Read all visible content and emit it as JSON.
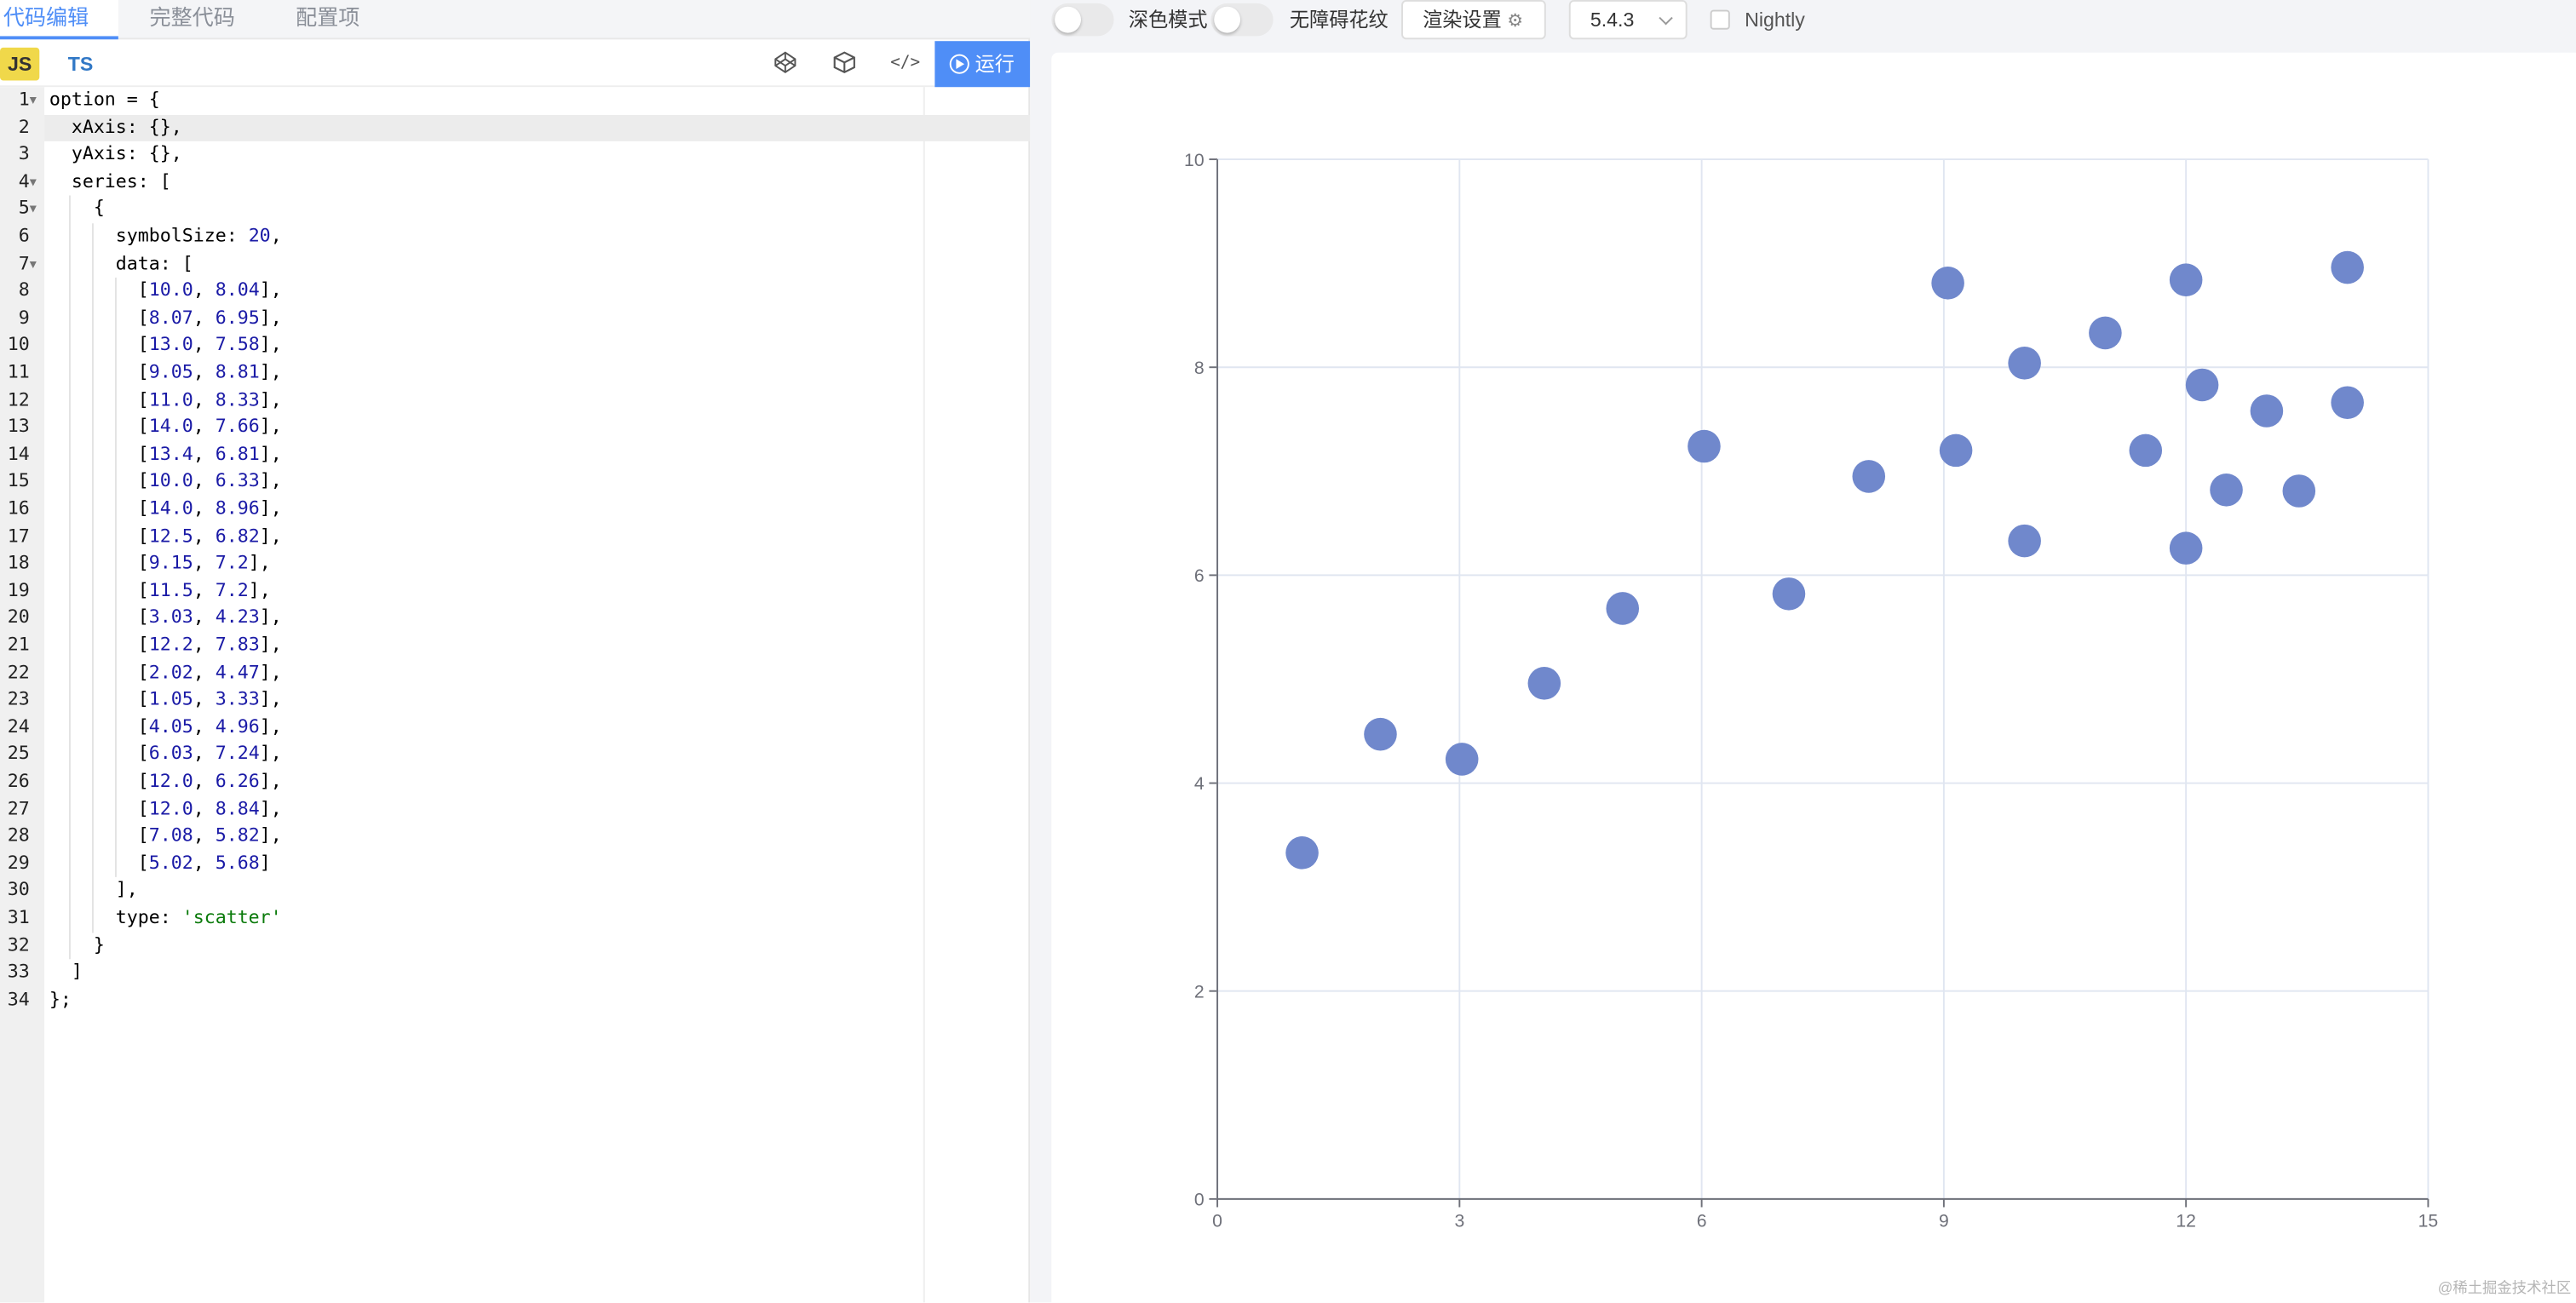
{
  "tabs": [
    "代码编辑",
    "完整代码",
    "配置项"
  ],
  "lang": {
    "js": "JS",
    "ts": "TS"
  },
  "run_label": "运行",
  "code_lines": [
    "option = {",
    "  xAxis: {},",
    "  yAxis: {},",
    "  series: [",
    "    {",
    "      symbolSize: 20,",
    "      data: [",
    "        [10.0, 8.04],",
    "        [8.07, 6.95],",
    "        [13.0, 7.58],",
    "        [9.05, 8.81],",
    "        [11.0, 8.33],",
    "        [14.0, 7.66],",
    "        [13.4, 6.81],",
    "        [10.0, 6.33],",
    "        [14.0, 8.96],",
    "        [12.5, 6.82],",
    "        [9.15, 7.2],",
    "        [11.5, 7.2],",
    "        [3.03, 4.23],",
    "        [12.2, 7.83],",
    "        [2.02, 4.47],",
    "        [1.05, 3.33],",
    "        [4.05, 4.96],",
    "        [6.03, 7.24],",
    "        [12.0, 6.26],",
    "        [12.0, 8.84],",
    "        [7.08, 5.82],",
    "        [5.02, 5.68]",
    "      ],",
    "      type: 'scatter'",
    "    }",
    "  ]",
    "};"
  ],
  "toolbar": {
    "dark_mode": "深色模式",
    "aria": "无障碍花纹",
    "render_settings": "渲染设置",
    "version": "5.4.3",
    "nightly": "Nightly"
  },
  "watermark": "@稀土掘金技术社区",
  "colors": {
    "accent": "#4f8ef7",
    "point": "#7088cc"
  },
  "chart_data": {
    "type": "scatter",
    "xlim": [
      0,
      15
    ],
    "ylim": [
      0,
      10
    ],
    "xticks": [
      "0",
      "3",
      "6",
      "9",
      "12",
      "15"
    ],
    "yticks": [
      "0",
      "2",
      "4",
      "6",
      "8",
      "10"
    ],
    "grid": true,
    "series": [
      {
        "points": [
          [
            10.0,
            8.04
          ],
          [
            8.07,
            6.95
          ],
          [
            13.0,
            7.58
          ],
          [
            9.05,
            8.81
          ],
          [
            11.0,
            8.33
          ],
          [
            14.0,
            7.66
          ],
          [
            13.4,
            6.81
          ],
          [
            10.0,
            6.33
          ],
          [
            14.0,
            8.96
          ],
          [
            12.5,
            6.82
          ],
          [
            9.15,
            7.2
          ],
          [
            11.5,
            7.2
          ],
          [
            3.03,
            4.23
          ],
          [
            12.2,
            7.83
          ],
          [
            2.02,
            4.47
          ],
          [
            1.05,
            3.33
          ],
          [
            4.05,
            4.96
          ],
          [
            6.03,
            7.24
          ],
          [
            12.0,
            6.26
          ],
          [
            12.0,
            8.84
          ],
          [
            7.08,
            5.82
          ],
          [
            5.02,
            5.68
          ]
        ]
      }
    ]
  }
}
